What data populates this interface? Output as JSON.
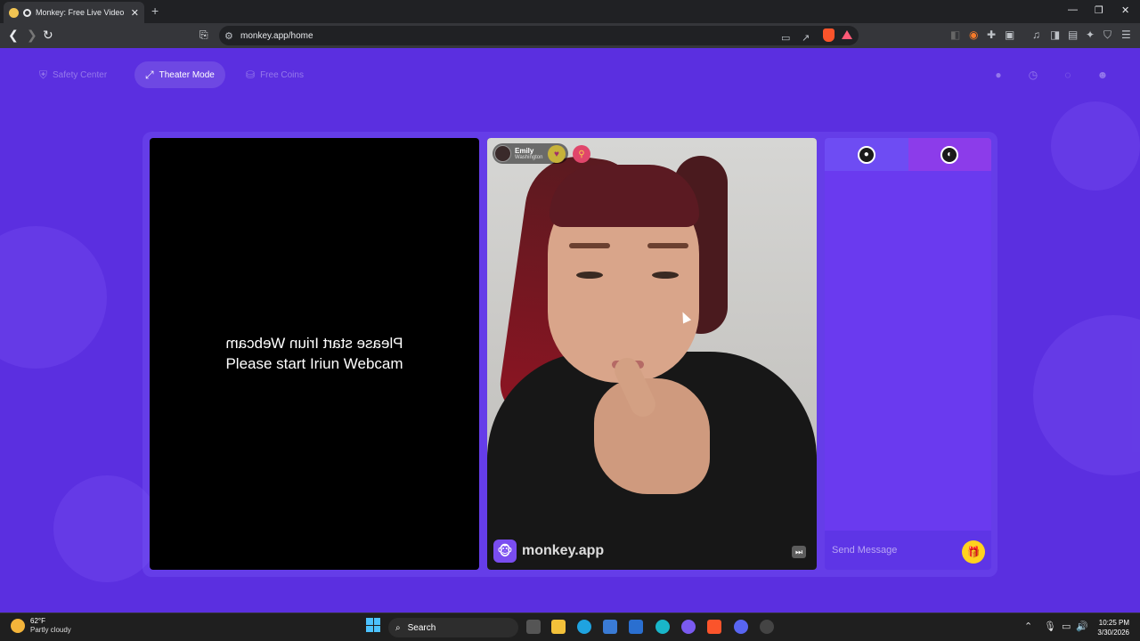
{
  "browser": {
    "tab_title": "Monkey: Free Live Video Chat",
    "tab_close": "✕",
    "new_tab": "+",
    "url": "monkey.app/home",
    "window_controls": {
      "minimize": "—",
      "restore": "❐",
      "close": "✕"
    },
    "icons": [
      "back-icon",
      "forward-icon",
      "reload-icon",
      "bookmark-icon",
      "site-info-icon",
      "cast-icon",
      "share-icon",
      "brave-shields-icon",
      "brave-rewards-icon",
      "extensions-icon",
      "sidebar-icon",
      "wallet-icon",
      "leo-icon",
      "vpn-icon",
      "menu-icon"
    ]
  },
  "topnav": {
    "safety_center": "Safety Center",
    "theater_mode": "Theater Mode",
    "free_coins": "Free Coins"
  },
  "left_panel": {
    "message_mirrored": "Please start Iriun Webcam",
    "message": "Please start Iriun Webcam"
  },
  "remote_user": {
    "name": "Emily",
    "location": "Washington",
    "brand": "monkey.app"
  },
  "chat": {
    "placeholder": "Send Message"
  },
  "taskbar": {
    "temp": "62°F",
    "condition": "Partly cloudy",
    "search": "Search",
    "time": "10:25 PM",
    "date": "3/30/2026"
  },
  "colors": {
    "page_bg": "#5b2fe0",
    "chat_bg": "#6a3aef",
    "accent_gift": "#ffd21f"
  }
}
